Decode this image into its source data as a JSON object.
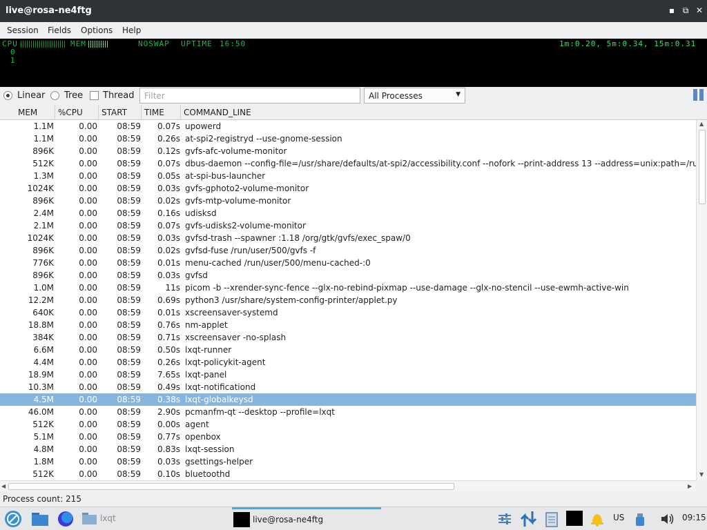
{
  "window": {
    "title": "live@rosa-ne4ftg",
    "buttons": {
      "minimize": "▪",
      "restore": "⧉",
      "close": "✕"
    }
  },
  "menu": [
    "Session",
    "Fields",
    "Options",
    "Help"
  ],
  "meters": {
    "cpu_label": "CPU",
    "mem_label": "MEM",
    "swap_label": "NOSWAP",
    "uptime_label": "UPTIME",
    "uptime": "16:50",
    "cpu_sub_0": "0",
    "cpu_sub_1": "1",
    "load": "1m:0.20, 5m:0.34, 15m:0.31",
    "colors": {
      "green": "#1cb84a",
      "blue": "#6b6bff"
    }
  },
  "filter_bar": {
    "mode_linear": "Linear",
    "mode_tree": "Tree",
    "mode_thread": "Thread",
    "selected_mode": "Linear",
    "filter_placeholder": "Filter",
    "filter_value": "",
    "process_select": "All Processes",
    "pause_icon": "pause-icon"
  },
  "columns": [
    "MEM",
    "%CPU",
    "START",
    "TIME",
    "COMMAND_LINE"
  ],
  "rows": [
    {
      "mem": "1.1M",
      "cpu": "0.00",
      "start": "08:59",
      "time": "0.07s",
      "cmd": "upowerd"
    },
    {
      "mem": "1.1M",
      "cpu": "0.00",
      "start": "08:59",
      "time": "0.26s",
      "cmd": "at-spi2-registryd --use-gnome-session"
    },
    {
      "mem": "896K",
      "cpu": "0.00",
      "start": "08:59",
      "time": "0.12s",
      "cmd": "gvfs-afc-volume-monitor"
    },
    {
      "mem": "512K",
      "cpu": "0.00",
      "start": "08:59",
      "time": "0.07s",
      "cmd": "dbus-daemon --config-file=/usr/share/defaults/at-spi2/accessibility.conf --nofork --print-address 13 --address=unix:path=/run/us"
    },
    {
      "mem": "1.3M",
      "cpu": "0.00",
      "start": "08:59",
      "time": "0.05s",
      "cmd": "at-spi-bus-launcher"
    },
    {
      "mem": "1024K",
      "cpu": "0.00",
      "start": "08:59",
      "time": "0.03s",
      "cmd": "gvfs-gphoto2-volume-monitor"
    },
    {
      "mem": "896K",
      "cpu": "0.00",
      "start": "08:59",
      "time": "0.02s",
      "cmd": "gvfs-mtp-volume-monitor"
    },
    {
      "mem": "2.4M",
      "cpu": "0.00",
      "start": "08:59",
      "time": "0.16s",
      "cmd": "udisksd"
    },
    {
      "mem": "2.1M",
      "cpu": "0.00",
      "start": "08:59",
      "time": "0.07s",
      "cmd": "gvfs-udisks2-volume-monitor"
    },
    {
      "mem": "1024K",
      "cpu": "0.00",
      "start": "08:59",
      "time": "0.03s",
      "cmd": "gvfsd-trash --spawner :1.18 /org/gtk/gvfs/exec_spaw/0"
    },
    {
      "mem": "896K",
      "cpu": "0.00",
      "start": "08:59",
      "time": "0.02s",
      "cmd": "gvfsd-fuse /run/user/500/gvfs -f"
    },
    {
      "mem": "776K",
      "cpu": "0.00",
      "start": "08:59",
      "time": "0.01s",
      "cmd": "menu-cached /run/user/500/menu-cached-:0"
    },
    {
      "mem": "896K",
      "cpu": "0.00",
      "start": "08:59",
      "time": "0.03s",
      "cmd": "gvfsd"
    },
    {
      "mem": "1.0M",
      "cpu": "0.00",
      "start": "08:59",
      "time": "11s",
      "cmd": "picom -b --xrender-sync-fence --glx-no-rebind-pixmap --use-damage --glx-no-stencil --use-ewmh-active-win"
    },
    {
      "mem": "12.2M",
      "cpu": "0.00",
      "start": "08:59",
      "time": "0.69s",
      "cmd": "python3 /usr/share/system-config-printer/applet.py"
    },
    {
      "mem": "640K",
      "cpu": "0.00",
      "start": "08:59",
      "time": "0.01s",
      "cmd": "xscreensaver-systemd"
    },
    {
      "mem": "18.8M",
      "cpu": "0.00",
      "start": "08:59",
      "time": "0.76s",
      "cmd": "nm-applet"
    },
    {
      "mem": "384K",
      "cpu": "0.00",
      "start": "08:59",
      "time": "0.71s",
      "cmd": "xscreensaver -no-splash"
    },
    {
      "mem": "6.6M",
      "cpu": "0.00",
      "start": "08:59",
      "time": "0.50s",
      "cmd": "lxqt-runner"
    },
    {
      "mem": "4.4M",
      "cpu": "0.00",
      "start": "08:59",
      "time": "0.26s",
      "cmd": "lxqt-policykit-agent"
    },
    {
      "mem": "18.9M",
      "cpu": "0.00",
      "start": "08:59",
      "time": "7.65s",
      "cmd": "lxqt-panel"
    },
    {
      "mem": "10.3M",
      "cpu": "0.00",
      "start": "08:59",
      "time": "0.49s",
      "cmd": "lxqt-notificationd"
    },
    {
      "mem": "4.5M",
      "cpu": "0.00",
      "start": "08:59",
      "time": "0.38s",
      "cmd": "lxqt-globalkeysd",
      "selected": true
    },
    {
      "mem": "46.0M",
      "cpu": "0.00",
      "start": "08:59",
      "time": "2.90s",
      "cmd": "pcmanfm-qt --desktop --profile=lxqt"
    },
    {
      "mem": "512K",
      "cpu": "0.00",
      "start": "08:59",
      "time": "0.00s",
      "cmd": "agent"
    },
    {
      "mem": "5.1M",
      "cpu": "0.00",
      "start": "08:59",
      "time": "0.77s",
      "cmd": "openbox"
    },
    {
      "mem": "4.8M",
      "cpu": "0.00",
      "start": "08:59",
      "time": "0.83s",
      "cmd": "lxqt-session"
    },
    {
      "mem": "1.8M",
      "cpu": "0.00",
      "start": "08:59",
      "time": "0.03s",
      "cmd": "gsettings-helper"
    },
    {
      "mem": "512K",
      "cpu": "0.00",
      "start": "08:59",
      "time": "0.10s",
      "cmd": "bluetoothd"
    }
  ],
  "status": {
    "process_count": "Process count: 215"
  },
  "taskbar": {
    "launcher_icon": "app-menu-icon",
    "folder_label": "lxqt",
    "active_task": "live@rosa-ne4ftg",
    "keyboard_layout": "US",
    "clock": "09:15",
    "accent": "#3daee9",
    "selection_color": "#86b5e0"
  }
}
